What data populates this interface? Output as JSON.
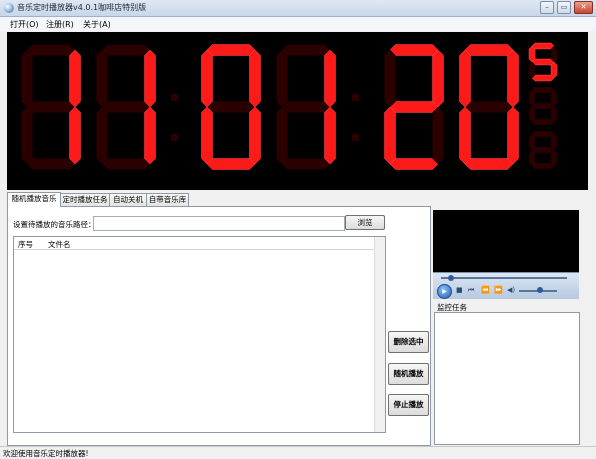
{
  "window": {
    "title": "音乐定时播放器v4.0.1咖啡店特别版",
    "icon": "app-icon",
    "controls": [
      "minimize-icon",
      "maximize-icon",
      "close-icon"
    ]
  },
  "menu": {
    "items": [
      "打开(O)",
      "注册(R)",
      "关于(A)"
    ]
  },
  "clock": {
    "hours": "11",
    "minutes": "01",
    "seconds_tens": "2",
    "seconds_ones": "0",
    "sub_digits": [
      "5",
      "",
      ""
    ],
    "color_on": "#ff1a1a",
    "color_off": "#2a0000"
  },
  "tabs": [
    "随机播放音乐",
    "定时播放任务",
    "自动关机",
    "自带音乐库"
  ],
  "random_tab": {
    "path_label": "设置待播放的音乐路径：",
    "path_value": "",
    "browse_label": "浏览",
    "columns": [
      "序号",
      "文件名"
    ],
    "rows": []
  },
  "actions": {
    "delete_selected": "删除选中",
    "random_play": "随机播放",
    "stop_play": "停止播放"
  },
  "player": {
    "seek_fraction": 0.08,
    "volume_fraction": 0.55
  },
  "monitor": {
    "label": "监控任务"
  },
  "status": {
    "text": "欢迎使用音乐定时播放器!"
  }
}
